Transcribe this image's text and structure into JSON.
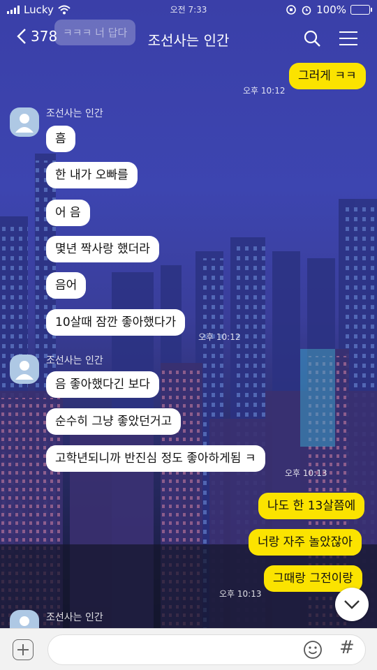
{
  "status": {
    "carrier": "Lucky",
    "time": "오전 7:33",
    "battery": "100%"
  },
  "header": {
    "back_count": "378",
    "title": "조선사는 인간"
  },
  "ghost_preview": "ㅋㅋㅋ 너 답다",
  "messages": {
    "m1": "그러게 ㅋㅋ",
    "t1": "오후 10:12",
    "sender": "조선사는 인간",
    "m2": "흠",
    "m3": "한 내가 오빠를",
    "m4": "어 음",
    "m5": "몇년 짝사랑 했더라",
    "m6": "음어",
    "m7": "10살때 잠깐 좋아했다가",
    "t2": "오후 10:12",
    "m8": "음 좋아했다긴 보다",
    "m9": "순수히 그냥 좋았던거고",
    "m10": "고학년되니까 반진심 정도 좋아하게됨 ㅋ",
    "t3": "오후 10:13",
    "m11": "나도 한 13살쯤에",
    "m12": "너랑 자주 놀았잖아",
    "m13": "그때랑 그전이랑",
    "t4": "오후 10:13"
  },
  "icons": {
    "back": "chevron-left-icon",
    "search": "search-icon",
    "menu": "menu-icon",
    "scroll_down": "chevron-down-icon",
    "attach": "plus-icon",
    "emoji": "emoji-icon",
    "hashtag": "#"
  },
  "colors": {
    "incoming_bubble": "#ffffff",
    "outgoing_bubble": "#fbe300",
    "battery_fill": "#4cd964"
  }
}
